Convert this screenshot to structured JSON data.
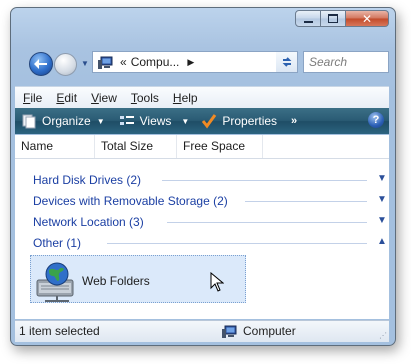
{
  "window": {
    "caption_buttons": [
      "minimize",
      "maximize",
      "close"
    ]
  },
  "nav": {
    "address_prefix": "«",
    "address_crumb": "Compu...",
    "search_placeholder": "Search"
  },
  "menu": [
    {
      "label": "File",
      "accel": "F",
      "rest": "ile"
    },
    {
      "label": "Edit",
      "accel": "E",
      "rest": "dit"
    },
    {
      "label": "View",
      "accel": "V",
      "rest": "iew"
    },
    {
      "label": "Tools",
      "accel": "T",
      "rest": "ools"
    },
    {
      "label": "Help",
      "accel": "H",
      "rest": "elp"
    }
  ],
  "command_bar": {
    "organize": "Organize",
    "views": "Views",
    "properties": "Properties",
    "more": "»",
    "help": "?"
  },
  "columns": [
    "Name",
    "Total Size",
    "Free Space"
  ],
  "groups": [
    {
      "label": "Hard Disk Drives (2)",
      "expanded": false
    },
    {
      "label": "Devices with Removable Storage (2)",
      "expanded": false
    },
    {
      "label": "Network Location (3)",
      "expanded": false
    },
    {
      "label": "Other (1)",
      "expanded": true
    }
  ],
  "items": [
    {
      "label": "Web Folders",
      "icon": "web-folders-icon",
      "selected": true
    }
  ],
  "status": {
    "left": "1 item selected",
    "right": "Computer"
  },
  "colors": {
    "group_text": "#1b3fa3",
    "command_bar": "#2a5b74",
    "selection": "#dbe9fa"
  }
}
